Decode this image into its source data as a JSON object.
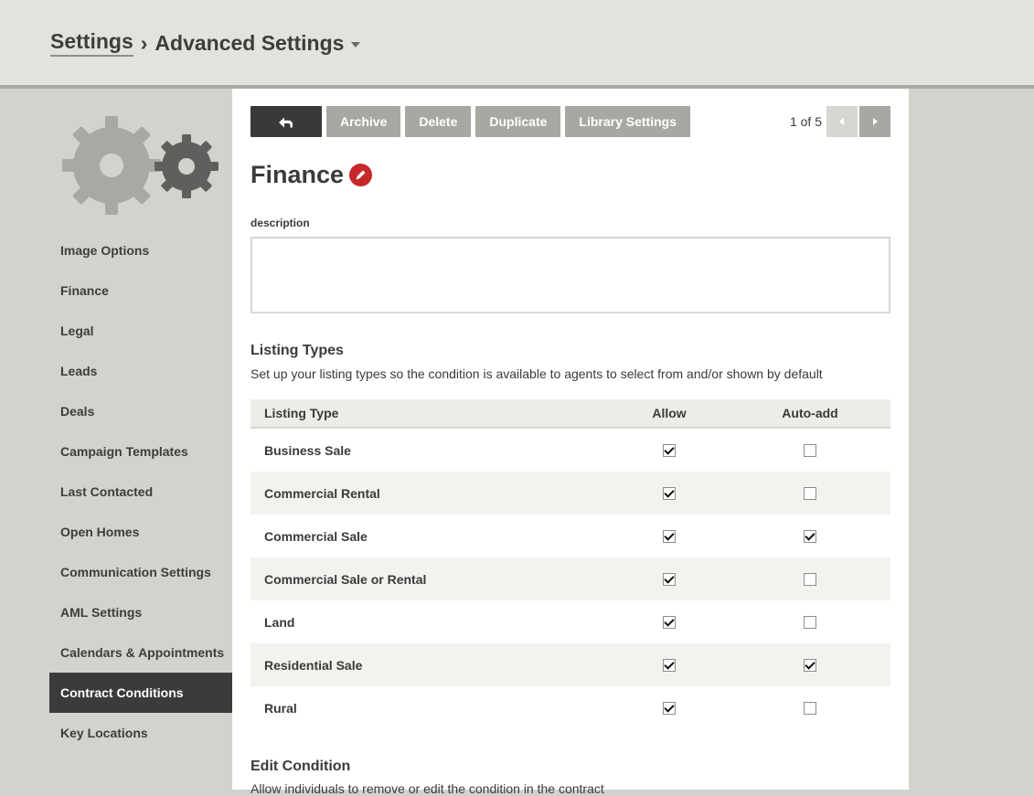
{
  "breadcrumb": {
    "root": "Settings",
    "separator": "›",
    "current": "Advanced Settings"
  },
  "sidebar": {
    "items": [
      {
        "label": "Image Options"
      },
      {
        "label": "Finance"
      },
      {
        "label": "Legal"
      },
      {
        "label": "Leads"
      },
      {
        "label": "Deals"
      },
      {
        "label": "Campaign Templates"
      },
      {
        "label": "Last Contacted"
      },
      {
        "label": "Open Homes"
      },
      {
        "label": "Communication Settings"
      },
      {
        "label": "AML Settings"
      },
      {
        "label": "Calendars & Appointments"
      },
      {
        "label": "Contract Conditions"
      },
      {
        "label": "Key Locations"
      }
    ],
    "active_index": 11
  },
  "toolbar": {
    "archive_label": "Archive",
    "delete_label": "Delete",
    "duplicate_label": "Duplicate",
    "library_settings_label": "Library Settings"
  },
  "pager": {
    "count": "1 of 5"
  },
  "record": {
    "title": "Finance"
  },
  "description": {
    "label": "description",
    "value": ""
  },
  "listing_types": {
    "title": "Listing Types",
    "subtitle": "Set up your listing types so the condition is available to agents to select from and/or shown by default",
    "headers": {
      "name": "Listing Type",
      "allow": "Allow",
      "auto_add": "Auto-add"
    },
    "rows": [
      {
        "name": "Business Sale",
        "allow": true,
        "auto_add": false
      },
      {
        "name": "Commercial Rental",
        "allow": true,
        "auto_add": false
      },
      {
        "name": "Commercial Sale",
        "allow": true,
        "auto_add": true
      },
      {
        "name": "Commercial Sale or Rental",
        "allow": true,
        "auto_add": false
      },
      {
        "name": "Land",
        "allow": true,
        "auto_add": false
      },
      {
        "name": "Residential Sale",
        "allow": true,
        "auto_add": true
      },
      {
        "name": "Rural",
        "allow": true,
        "auto_add": false
      }
    ]
  },
  "edit_condition": {
    "title": "Edit Condition",
    "subtitle": "Allow individuals to remove or edit the condition in the contract"
  },
  "colors": {
    "accent": "#c7282a",
    "active_nav": "#3b3b3b",
    "button": "#a8a7a2"
  }
}
